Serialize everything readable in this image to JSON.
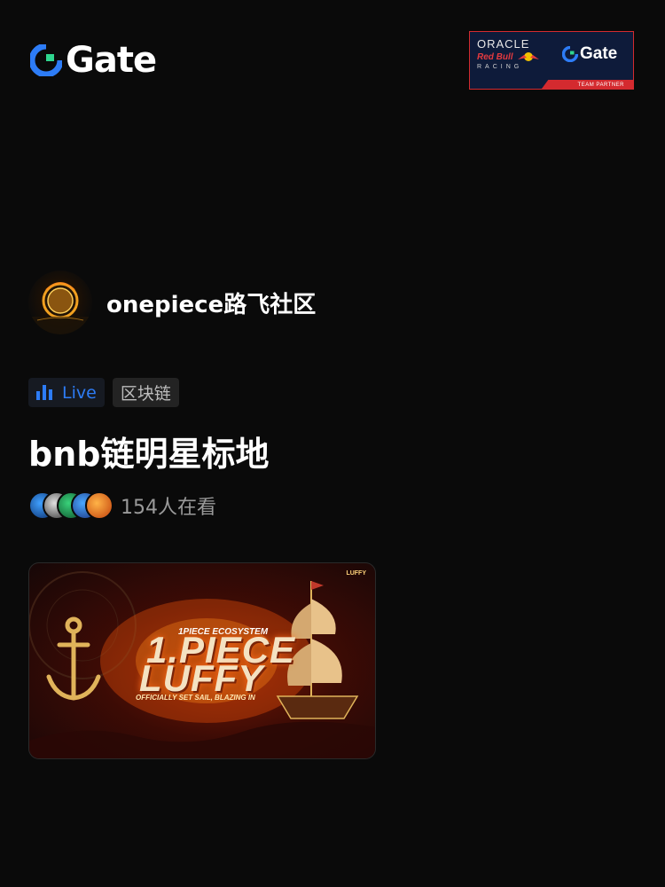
{
  "header": {
    "logo_text": "Gate",
    "brand_color": "#2d7cf6",
    "partner": {
      "oracle": "ORACLE",
      "redbull": "Red Bull",
      "racing": "RACING",
      "gate": "Gate",
      "team_partner": "TEAM PARTNER"
    }
  },
  "community": {
    "name": "onepiece路飞社区"
  },
  "tags": {
    "live": "Live",
    "category": "区块链"
  },
  "room": {
    "title": "bnb链明星标地",
    "viewer_count": "154人在看"
  },
  "banner": {
    "corner_label": "LUFFY",
    "ecosystem": "1PIECE ECOSYSTEM",
    "line1": "1.PIECE",
    "line2": "LUFFY",
    "subtitle": "OFFICIALLY SET SAIL, BLAZING IN"
  }
}
